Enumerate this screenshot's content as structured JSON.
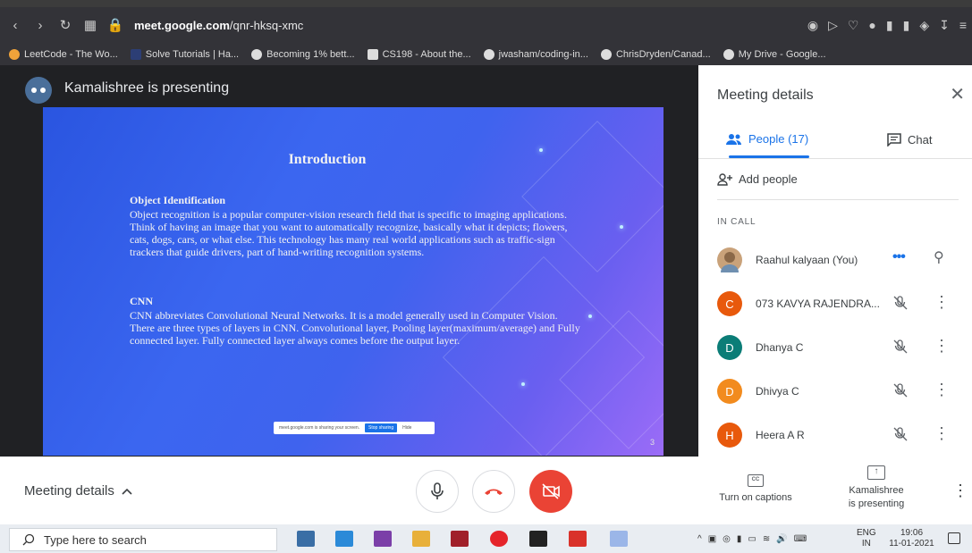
{
  "browser": {
    "url_domain": "meet.google.com",
    "url_path": "/qnr-hksq-xmc",
    "bookmarks": [
      "LeetCode - The Wo...",
      "Solve Tutorials | Ha...",
      "Becoming 1% bett...",
      "CS198 - About the...",
      "jwasham/coding-in...",
      "ChrisDryden/Canad...",
      "My Drive - Google..."
    ]
  },
  "meet": {
    "presenting_title": "Kamalishree is presenting",
    "slide": {
      "title": "Introduction",
      "section1_heading": "Object Identification",
      "section1_text": "Object recognition is a popular computer-vision research field that is specific to imaging applications. Think of having an image that you want to automatically recognize, basically what it depicts; flowers, cats, dogs, cars, or what else.  This technology has many real world applications such as traffic-sign trackers that guide drivers, part of hand-writing recognition systems.",
      "section2_heading": "CNN",
      "section2_text": "CNN abbreviates Convolutional Neural Networks. It is a model generally used in Computer Vision. There are three types of layers in CNN. Convolutional layer, Pooling layer(maximum/average) and Fully connected layer. Fully connected layer always comes before the output layer.",
      "share_bar_text": "meet.google.com is sharing your screen.",
      "share_bar_stop": "Stop sharing",
      "share_bar_hide": "Hide",
      "page_number": "3"
    }
  },
  "panel": {
    "title": "Meeting details",
    "close": "✕",
    "tab_people": "People (17)",
    "tab_chat": "Chat",
    "add_people": "Add people",
    "in_call": "IN CALL",
    "people": [
      {
        "name": "Raahul kalyaan (You)",
        "initial": "",
        "color": "#c9a27a"
      },
      {
        "name": "073 KAVYA RAJENDRA...",
        "initial": "C",
        "color": "#e8590c"
      },
      {
        "name": "Dhanya C",
        "initial": "D",
        "color": "#0b7d77"
      },
      {
        "name": "Dhivya C",
        "initial": "D",
        "color": "#f28b1e"
      },
      {
        "name": "Heera A R",
        "initial": "H",
        "color": "#e8590c"
      }
    ]
  },
  "controls": {
    "meeting_details": "Meeting details",
    "captions": "Turn on captions",
    "presenting_line1": "Kamalishree",
    "presenting_line2": "is presenting"
  },
  "taskbar": {
    "search_placeholder": "Type here to search",
    "lang_line1": "ENG",
    "lang_line2": "IN",
    "time": "19:06",
    "date": "11-01-2021"
  },
  "colors": {
    "accent": "#1a73e8",
    "end_call": "#ea4335"
  }
}
